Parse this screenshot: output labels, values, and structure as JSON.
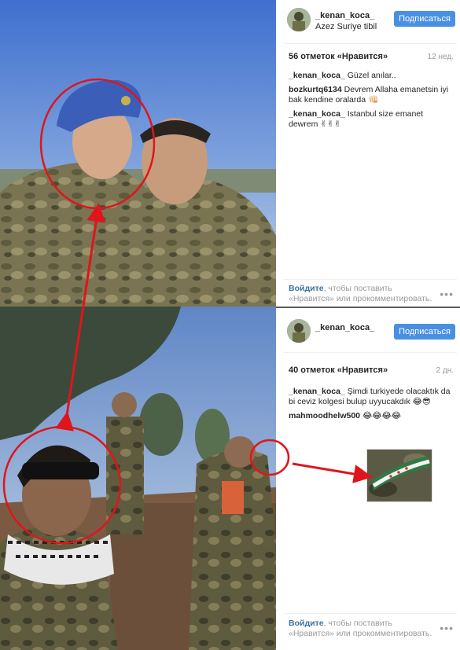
{
  "post1": {
    "username": "_kenan_koca_",
    "location": "Azez Suriye tibil",
    "follow_label": "Подписаться",
    "likes": "56 отметок «Нравится»",
    "age": "12 нед.",
    "comments": [
      {
        "user": "_kenan_koca_",
        "text": "Güzel anılar.."
      },
      {
        "user": "bozkurtq6134",
        "text": "Devrem Allaha emanetsin iyi bak kendine oralarda 👊🏻"
      },
      {
        "user": "_kenan_koca_",
        "text": "Istanbul size emanet dewrem ✌✌✌"
      }
    ],
    "login_link": "Войдите",
    "login_text": ", чтобы поставить «Нравится» или прокомментировать."
  },
  "post2": {
    "username": "_kenan_koca_",
    "follow_label": "Подписаться",
    "likes": "40 отметок «Нравится»",
    "age": "2 дн.",
    "comments": [
      {
        "user": "_kenan_koca_",
        "text": "Şimdi turkiyede olacaktık da bi ceviz kolgesi bulup uyyucakdık 😂😎"
      },
      {
        "user": "mahmoodhelw500",
        "text": "😂😂😂😂"
      }
    ],
    "login_link": "Войдите",
    "login_text": ", чтобы поставить «Нравится» или прокомментировать."
  },
  "more_label": "•••",
  "colors": {
    "follow_button": "#4a90e2",
    "annotation_red": "#e0151b",
    "sky": "#5e8ed8",
    "uniform": "#6f6a48"
  },
  "icons": [
    "more-options-icon",
    "annotation-arrow-icon"
  ]
}
